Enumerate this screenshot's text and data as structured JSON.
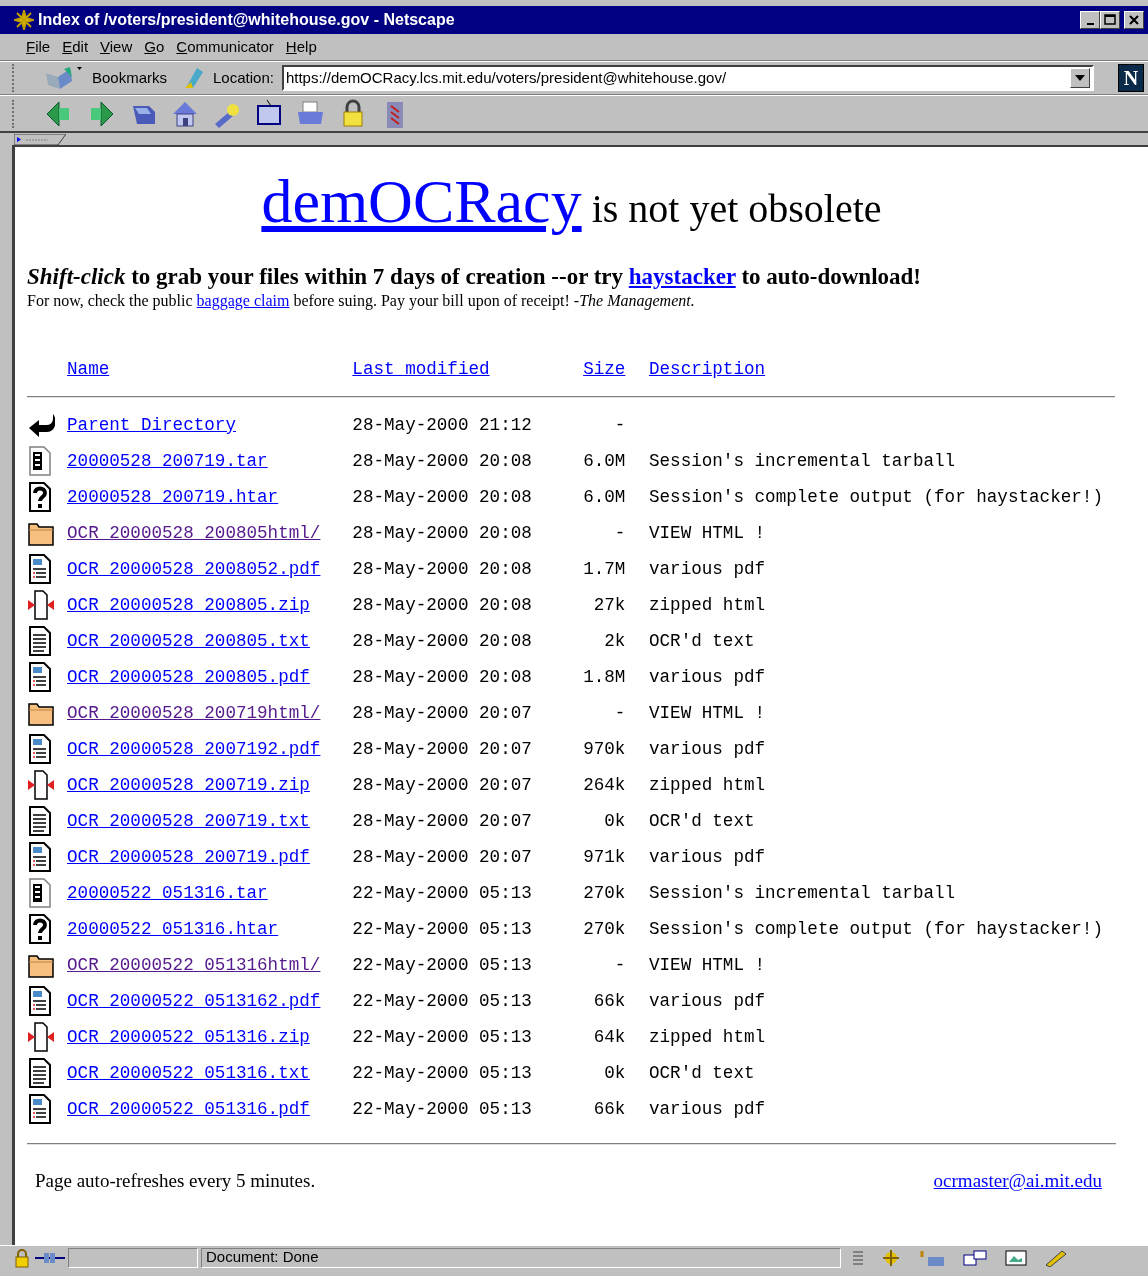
{
  "window": {
    "title": "Index of /voters/president@whitehouse.gov - Netscape"
  },
  "menu": [
    "File",
    "Edit",
    "View",
    "Go",
    "Communicator",
    "Help"
  ],
  "location_bar": {
    "bookmarks": "Bookmarks",
    "label": "Location:",
    "url": "https://demOCRacy.lcs.mit.edu/voters/president@whitehouse.gov/",
    "logo": "N"
  },
  "heading": {
    "link": "demOCRacy",
    "text": " is not yet obsolete"
  },
  "instructions": {
    "before": "*Shift-click* to grab your files within 7 days of creation --or try ",
    "link": "haystacker",
    "after": " to auto-download!"
  },
  "notice": {
    "before": "For now, check the public ",
    "link": "baggage claim",
    "after": " before suing. Pay your bill upon of receipt!   *-The Management.*"
  },
  "table": {
    "columns": [
      "Name",
      "Last modified",
      "Size",
      "Description"
    ],
    "rows": [
      {
        "kind": "back",
        "name": "Parent Directory",
        "visited": false,
        "modified": "28-May-2000 21:12",
        "size": "-",
        "description": ""
      },
      {
        "kind": "tar",
        "name": "20000528 200719.tar",
        "visited": false,
        "modified": "28-May-2000 20:08",
        "size": "6.0M",
        "description": "Session's incremental tarball"
      },
      {
        "kind": "unknown",
        "name": "20000528 200719.htar",
        "visited": false,
        "modified": "28-May-2000 20:08",
        "size": "6.0M",
        "description": "Session's complete output (for haystacker!)"
      },
      {
        "kind": "folder",
        "name": "OCR 20000528 200805html/",
        "visited": true,
        "modified": "28-May-2000 20:08",
        "size": "-",
        "description": "VIEW HTML !"
      },
      {
        "kind": "layout",
        "name": "OCR 20000528 2008052.pdf",
        "visited": false,
        "modified": "28-May-2000 20:08",
        "size": "1.7M",
        "description": "various pdf"
      },
      {
        "kind": "compressed",
        "name": "OCR 20000528 200805.zip",
        "visited": false,
        "modified": "28-May-2000 20:08",
        "size": "27k",
        "description": "zipped html"
      },
      {
        "kind": "text",
        "name": "OCR 20000528 200805.txt",
        "visited": false,
        "modified": "28-May-2000 20:08",
        "size": "2k",
        "description": "OCR'd text"
      },
      {
        "kind": "layout",
        "name": "OCR 20000528 200805.pdf",
        "visited": false,
        "modified": "28-May-2000 20:08",
        "size": "1.8M",
        "description": "various pdf"
      },
      {
        "kind": "folder",
        "name": "OCR 20000528 200719html/",
        "visited": true,
        "modified": "28-May-2000 20:07",
        "size": "-",
        "description": "VIEW HTML !"
      },
      {
        "kind": "layout",
        "name": "OCR 20000528 2007192.pdf",
        "visited": false,
        "modified": "28-May-2000 20:07",
        "size": "970k",
        "description": "various pdf"
      },
      {
        "kind": "compressed",
        "name": "OCR 20000528 200719.zip",
        "visited": false,
        "modified": "28-May-2000 20:07",
        "size": "264k",
        "description": "zipped html"
      },
      {
        "kind": "text",
        "name": "OCR 20000528 200719.txt",
        "visited": false,
        "modified": "28-May-2000 20:07",
        "size": "0k",
        "description": "OCR'd text"
      },
      {
        "kind": "layout",
        "name": "OCR 20000528 200719.pdf",
        "visited": false,
        "modified": "28-May-2000 20:07",
        "size": "971k",
        "description": "various pdf"
      },
      {
        "kind": "tar",
        "name": "20000522 051316.tar",
        "visited": false,
        "modified": "22-May-2000 05:13",
        "size": "270k",
        "description": "Session's incremental tarball"
      },
      {
        "kind": "unknown",
        "name": "20000522 051316.htar",
        "visited": false,
        "modified": "22-May-2000 05:13",
        "size": "270k",
        "description": "Session's complete output (for haystacker!)"
      },
      {
        "kind": "folder",
        "name": "OCR 20000522 051316html/",
        "visited": true,
        "modified": "22-May-2000 05:13",
        "size": "-",
        "description": "VIEW HTML !"
      },
      {
        "kind": "layout",
        "name": "OCR 20000522 0513162.pdf",
        "visited": false,
        "modified": "22-May-2000 05:13",
        "size": "66k",
        "description": "various pdf"
      },
      {
        "kind": "compressed",
        "name": "OCR 20000522 051316.zip",
        "visited": false,
        "modified": "22-May-2000 05:13",
        "size": "64k",
        "description": "zipped html"
      },
      {
        "kind": "text",
        "name": "OCR 20000522 051316.txt",
        "visited": false,
        "modified": "22-May-2000 05:13",
        "size": "0k",
        "description": "OCR'd text"
      },
      {
        "kind": "layout",
        "name": "OCR 20000522 051316.pdf",
        "visited": false,
        "modified": "22-May-2000 05:13",
        "size": "66k",
        "description": "various pdf"
      }
    ]
  },
  "footer": {
    "text": "Page auto-refreshes every 5 minutes.",
    "email": "ocrmaster@ai.mit.edu"
  },
  "status_bar": {
    "text": "Document: Done"
  }
}
